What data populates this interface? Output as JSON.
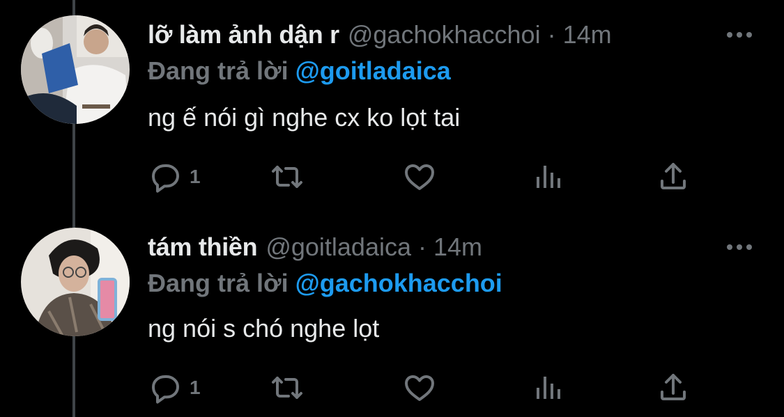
{
  "tweets": [
    {
      "display_name": "lỡ làm ảnh dận r",
      "handle": "@gachokhacchoi",
      "separator": "·",
      "time": "14m",
      "reply_prefix": "Đang trả lời",
      "reply_to": "@goitladaica",
      "text": "ng ế nói gì nghe cx ko lọt tai",
      "reply_count": "1",
      "icons": [
        "reply-icon",
        "retweet-icon",
        "like-icon",
        "views-icon",
        "share-icon",
        "more-icon"
      ]
    },
    {
      "display_name": "tám thiền",
      "handle": "@goitladaica",
      "separator": "·",
      "time": "14m",
      "reply_prefix": "Đang trả lời",
      "reply_to": "@gachokhacchoi",
      "text": "ng nói s chó nghe lọt",
      "reply_count": "1",
      "icons": [
        "reply-icon",
        "retweet-icon",
        "like-icon",
        "views-icon",
        "share-icon",
        "more-icon"
      ]
    }
  ],
  "colors": {
    "background": "#000000",
    "text_primary": "#e7e9ea",
    "text_secondary": "#71767b",
    "accent": "#1d9bf0",
    "thread_line": "#3f4448"
  }
}
